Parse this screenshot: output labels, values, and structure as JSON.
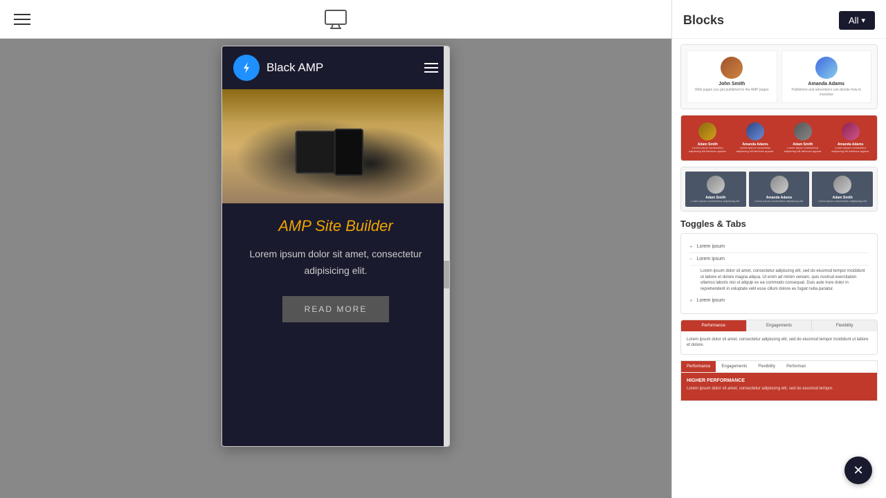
{
  "topbar": {
    "monitor_label": "monitor"
  },
  "phone_preview": {
    "nav": {
      "title": "Black AMP"
    },
    "headline": "AMP Site Builder",
    "body_text": "Lorem ipsum dolor sit amet, consectetur adipisicing elit.",
    "cta_label": "READ MORE"
  },
  "sidebar": {
    "title": "Blocks",
    "all_button": "All",
    "sections": {
      "toggles_tabs_label": "Toggles & Tabs"
    },
    "toggle_block": {
      "row1": "Lorem ipsum",
      "row2": "Lorem ipsum",
      "row3": "Lorem ipsum"
    },
    "tabs_block": {
      "tab1": "Performance",
      "tab2": "Engagements",
      "tab3": "Flexibility",
      "content": "Lorem ipsum dolor sit amet, consectetur adipiscing elit, sed do eiusmod tempor incididunt ut labore et dolore."
    },
    "red_tabs_block": {
      "tab1": "Performance",
      "tab2": "Engagements",
      "tab3": "Flexibility",
      "tab4": "Performan",
      "section_title": "HIGHER PERFORMANCE",
      "content": "Lorem ipsum dolor sit amet, consectetur adipiscing elit, sed do eiusmod tempor."
    },
    "team_members": {
      "col2": [
        {
          "name": "John Smith",
          "desc": "Web pages you get published to the AMP pages"
        },
        {
          "name": "Amanda Adams",
          "desc": "Publishers and advertisers can decide how to monetize"
        }
      ],
      "col4": [
        {
          "name": "Adam Smith",
          "desc": "Lorem ipsum consectetur adipiscing elit fabulous appear."
        },
        {
          "name": "Amanda Adams",
          "desc": "Lorem ipsum consectetur adipiscing elit fabulous appear."
        },
        {
          "name": "Adam Smith",
          "desc": "Lorem ipsum consectetur adipiscing elit fabulous appear."
        },
        {
          "name": "Amanda Adams",
          "desc": "Lorem ipsum consectetur adipiscing elit fabulous appear."
        }
      ],
      "col3": [
        {
          "name": "Adam Smith",
          "desc": "Lorem ipsum consectetur adipiscing elit."
        },
        {
          "name": "Amanda Adams",
          "desc": "Lorem ipsum consectetur adipiscing elit."
        },
        {
          "name": "Adam Smith",
          "desc": "Lorem ipsum consectetur adipiscing elit."
        }
      ]
    }
  }
}
